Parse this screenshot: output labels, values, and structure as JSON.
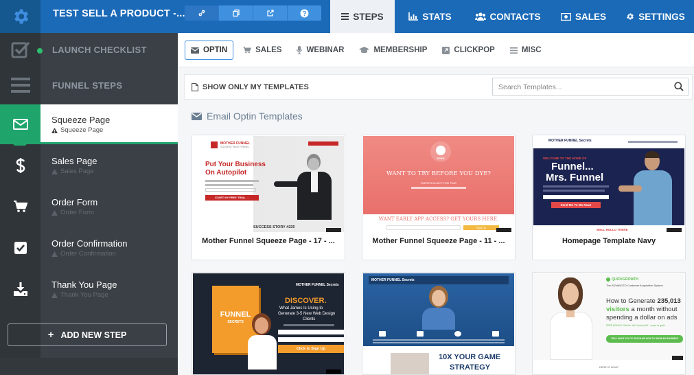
{
  "header": {
    "funnel_title": "TEST SELL A PRODUCT -...",
    "tools": [
      "link-icon",
      "copy-icon",
      "external-link-icon",
      "help-icon"
    ],
    "tabs": [
      {
        "label": "STEPS",
        "icon": "list-icon",
        "active": true
      },
      {
        "label": "STATS",
        "icon": "bar-chart-icon"
      },
      {
        "label": "CONTACTS",
        "icon": "users-icon"
      },
      {
        "label": "SALES",
        "icon": "money-icon"
      },
      {
        "label": "SETTINGS",
        "icon": "gear-icon"
      }
    ]
  },
  "sidebar": {
    "launch_checklist": "LAUNCH CHECKLIST",
    "funnel_steps": "FUNNEL STEPS",
    "steps": [
      {
        "title": "Squeeze Page",
        "subtitle": "Squeeze Page",
        "icon": "envelope-icon",
        "active": true
      },
      {
        "title": "Sales Page",
        "subtitle": "Sales Page",
        "icon": "dollar-icon"
      },
      {
        "title": "Order Form",
        "subtitle": "Order Form",
        "icon": "cart-icon"
      },
      {
        "title": "Order Confirmation",
        "subtitle": "Order Confirmation",
        "icon": "checkbox-icon"
      },
      {
        "title": "Thank You Page",
        "subtitle": "Thank You Page",
        "icon": "download-icon"
      }
    ],
    "add_step": "ADD NEW STEP"
  },
  "categories": [
    {
      "label": "OPTIN",
      "icon": "envelope-icon",
      "active": true
    },
    {
      "label": "SALES",
      "icon": "cart-icon"
    },
    {
      "label": "WEBINAR",
      "icon": "microphone-icon"
    },
    {
      "label": "MEMBERSHIP",
      "icon": "graduation-cap-icon"
    },
    {
      "label": "CLICKPOP",
      "icon": "external-link-icon"
    },
    {
      "label": "MISC",
      "icon": "list-icon"
    }
  ],
  "filter": {
    "show_only_mine": "SHOW ONLY MY TEMPLATES",
    "search_placeholder": "Search Templates..."
  },
  "section_title": "Email Optin Templates",
  "templates": [
    {
      "title": "Mother Funnel Squeeze Page - 17 - ...",
      "thumb": {
        "brand": "MOTHER FUNNEL",
        "tagline": "SQUEEZE PAGE FUNNEL",
        "headline1": "Put Your Business",
        "headline2": "On Autopilot",
        "cta": "START MY FREE TRIAL →",
        "story": "SUCCESS STORY #225"
      }
    },
    {
      "title": "Mother Funnel Squeeze Page - 11 - ...",
      "thumb": {
        "brand": "APIFA",
        "headline": "WANT TO TRY BEFORE YOU DYE?",
        "sub": "THERE'S AN APP FOR THAT.",
        "early": "WANT EARLY APP ACCESS? GET YOURS HERE.",
        "cta": "Sign Up"
      }
    },
    {
      "title": "Homepage Template Navy",
      "thumb": {
        "brand": "MOTHER FUNNEL Secrets",
        "kicker": "WELCOME TO THE HOME OF",
        "headline1": "Funnel...",
        "headline2": "Mrs. Funnel",
        "cta": "Send Me To Ms Now!",
        "note": "WELL HELLO THERE"
      }
    },
    {
      "title": "",
      "thumb": {
        "brand": "MOTHER FUNNEL Secrets",
        "book": "FUNNEL",
        "book_sub": "SECRETS",
        "headline": "DISCOVER.",
        "sub1": "What James Is Using to",
        "sub2": "Generate 3-5 New Web Design",
        "sub3": "Clients",
        "cta": "Click to Sign Up"
      }
    },
    {
      "title": "",
      "thumb": {
        "brand": "MOTHER FUNNEL Secrets",
        "headline1": "10X YOUR GAME",
        "headline2": "STRATEGY"
      }
    },
    {
      "title": "",
      "thumb": {
        "brand": "QUICKGROWTH",
        "kicker": "The ADVANCED Customer Acquisition System",
        "headline1": "How to Generate",
        "headline_num": "235,013",
        "headline2": "visitors",
        "headline3": "a month without",
        "headline4": "spending a dollar on ads",
        "free": "FREE BONUS: Get the 'Ad Formula Kit' - yours to grab!",
        "cta": "YES, I WANT YOU TO TEACH ME HOW TO GROW MY BUSINESS",
        "note": "HERE IS WHAT"
      }
    }
  ]
}
